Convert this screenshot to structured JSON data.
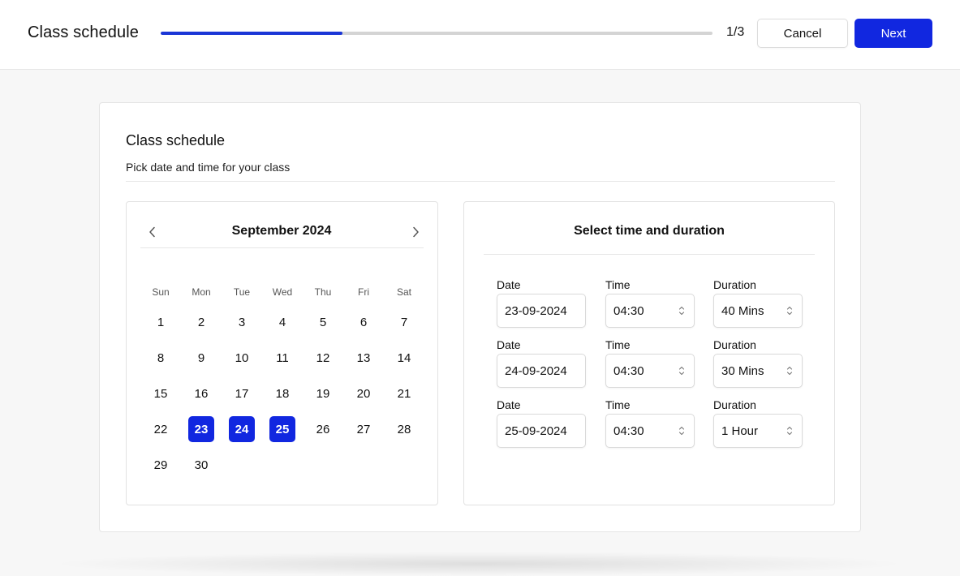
{
  "header": {
    "title": "Class schedule",
    "progress": 0.33,
    "step_counter": "1/3",
    "cancel_label": "Cancel",
    "next_label": "Next",
    "accent_color": "#1127e0"
  },
  "card": {
    "title": "Class schedule",
    "subtitle": "Pick date and time for your class"
  },
  "calendar": {
    "month_label": "September 2024",
    "prev_icon": "chevron-left-icon",
    "next_icon": "chevron-right-icon",
    "weekdays": [
      "Sun",
      "Mon",
      "Tue",
      "Wed",
      "Thu",
      "Fri",
      "Sat"
    ],
    "weeks": [
      [
        "1",
        "2",
        "3",
        "4",
        "5",
        "6",
        "7"
      ],
      [
        "8",
        "9",
        "10",
        "11",
        "12",
        "13",
        "14"
      ],
      [
        "15",
        "16",
        "17",
        "18",
        "19",
        "20",
        "21"
      ],
      [
        "22",
        "23",
        "24",
        "25",
        "26",
        "27",
        "28"
      ],
      [
        "29",
        "30",
        "",
        "",
        "",
        "",
        ""
      ]
    ],
    "selected_days": [
      "23",
      "24",
      "25"
    ]
  },
  "time_panel": {
    "title": "Select time and duration",
    "date_label": "Date",
    "time_label": "Time",
    "duration_label": "Duration",
    "slots": [
      {
        "date": "23-09-2024",
        "time": "04:30",
        "duration": "40 Mins"
      },
      {
        "date": "24-09-2024",
        "time": "04:30",
        "duration": "30 Mins"
      },
      {
        "date": "25-09-2024",
        "time": "04:30",
        "duration": "1 Hour"
      }
    ]
  }
}
